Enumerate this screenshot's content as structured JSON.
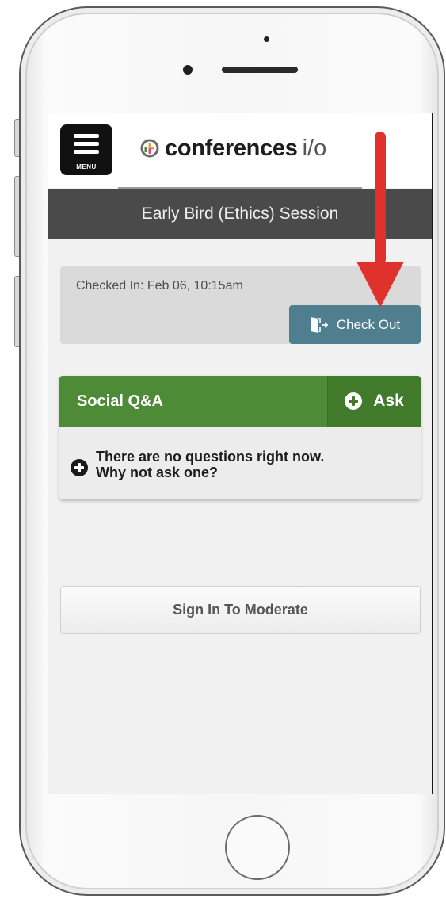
{
  "app": {
    "menu_label": "MENU",
    "logo_text": "conferences",
    "logo_suffix": "i/o"
  },
  "session": {
    "title": "Early Bird (Ethics) Session"
  },
  "checkin": {
    "status_text": "Checked In: Feb 06, 10:15am",
    "checkout_label": "Check Out"
  },
  "qa": {
    "title": "Social Q&A",
    "ask_label": "Ask",
    "empty_line1": "There are no questions right now.",
    "empty_line2": "Why not ask one?"
  },
  "moderate": {
    "label": "Sign In To Moderate"
  },
  "colors": {
    "session_bar": "#4a4a4a",
    "checkout_button": "#4f7f8f",
    "qa_header": "#4e8b36",
    "ask_button": "#417a2b",
    "annotation_arrow": "#e0322c"
  },
  "icons": {
    "menu": "hamburger-icon",
    "logo": "conferences-io-logo-icon",
    "checkout": "door-exit-icon",
    "ask": "plus-circle-icon",
    "empty_state": "plus-circle-icon",
    "annotation": "red-down-arrow-icon"
  }
}
